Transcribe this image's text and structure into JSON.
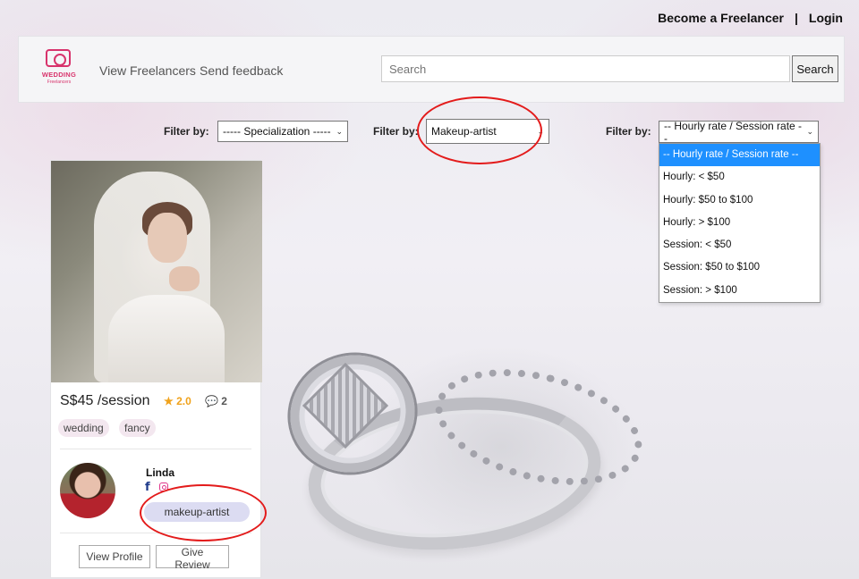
{
  "top_links": {
    "become_freelancer": "Become a Freelancer",
    "separator": "|",
    "login": "Login"
  },
  "logo": {
    "title": "WEDDING",
    "subtitle": "Freelancers"
  },
  "nav": {
    "view_freelancers": "View Freelancers",
    "send_feedback": "Send feedback"
  },
  "search": {
    "placeholder": "Search",
    "button_label": "Search"
  },
  "filters": [
    {
      "label": "Filter by:",
      "selected": "----- Specialization -----"
    },
    {
      "label": "Filter by:",
      "selected": "Makeup-artist"
    },
    {
      "label": "Filter by:",
      "selected": "-- Hourly rate / Session rate --"
    }
  ],
  "rate_dropdown": {
    "options": [
      "-- Hourly rate / Session rate --",
      "Hourly: < $50",
      "Hourly: $50 to $100",
      "Hourly: > $100",
      "Session: < $50",
      "Session: $50 to $100",
      "Session: > $100"
    ],
    "highlighted_index": 0
  },
  "card": {
    "price": "S$45 /session",
    "rating": "2.0",
    "comments": "2",
    "tags": [
      "wedding",
      "fancy"
    ],
    "freelancer_name": "Linda",
    "specialization": "makeup-artist",
    "view_profile": "View Profile",
    "give_review": "Give Review"
  },
  "icons": {
    "star": "star-icon",
    "comment": "comment-icon",
    "facebook": "facebook-icon",
    "instagram": "instagram-icon",
    "chevron": "chevron-down-icon"
  },
  "colors": {
    "brand": "#d8336c",
    "highlight": "#1e90ff",
    "rating": "#f0a21b",
    "annotation": "#e31b1b"
  }
}
